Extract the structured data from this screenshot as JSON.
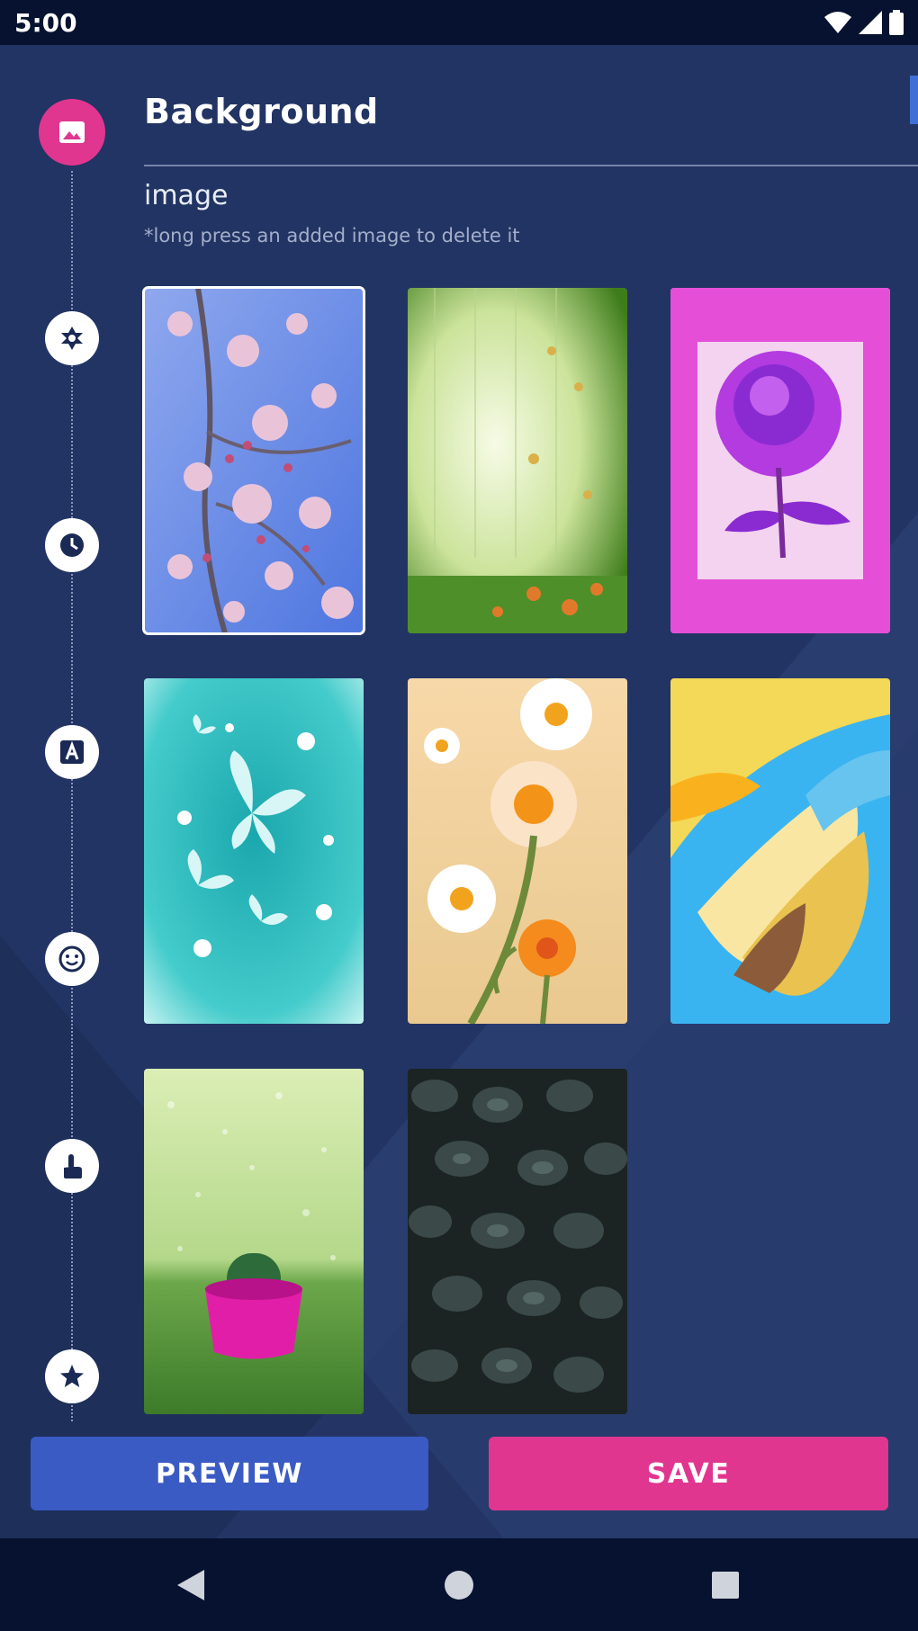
{
  "status_bar": {
    "time": "5:00",
    "icons": [
      "wifi-icon",
      "cell-signal-icon",
      "battery-icon"
    ]
  },
  "header": {
    "title": "Background",
    "subtitle": "image",
    "hint": "*long press an added image to delete it"
  },
  "sidebar": {
    "items": [
      {
        "name": "image-icon",
        "active": true
      },
      {
        "name": "settings-gear-icon",
        "active": false
      },
      {
        "name": "clock-icon",
        "active": false
      },
      {
        "name": "font-icon",
        "active": false
      },
      {
        "name": "emoji-icon",
        "active": false
      },
      {
        "name": "touch-icon",
        "active": false
      },
      {
        "name": "star-icon",
        "active": false
      }
    ]
  },
  "gallery": {
    "images": [
      {
        "name": "cherry-blossom",
        "selected": true
      },
      {
        "name": "green-garden",
        "selected": false
      },
      {
        "name": "pink-rose",
        "selected": false
      },
      {
        "name": "butterflies",
        "selected": false
      },
      {
        "name": "daisies",
        "selected": false
      },
      {
        "name": "abstract-swirl",
        "selected": false
      },
      {
        "name": "cactus-pot",
        "selected": false
      },
      {
        "name": "dark-leaves",
        "selected": false
      }
    ]
  },
  "actions": {
    "preview_label": "PREVIEW",
    "save_label": "SAVE"
  },
  "colors": {
    "panel": "#223463",
    "accent_pink": "#e0368f",
    "accent_blue": "#3a5bc4",
    "system_bar": "#06122f"
  },
  "nav": {
    "items": [
      "back-icon",
      "home-icon",
      "recents-icon"
    ]
  }
}
